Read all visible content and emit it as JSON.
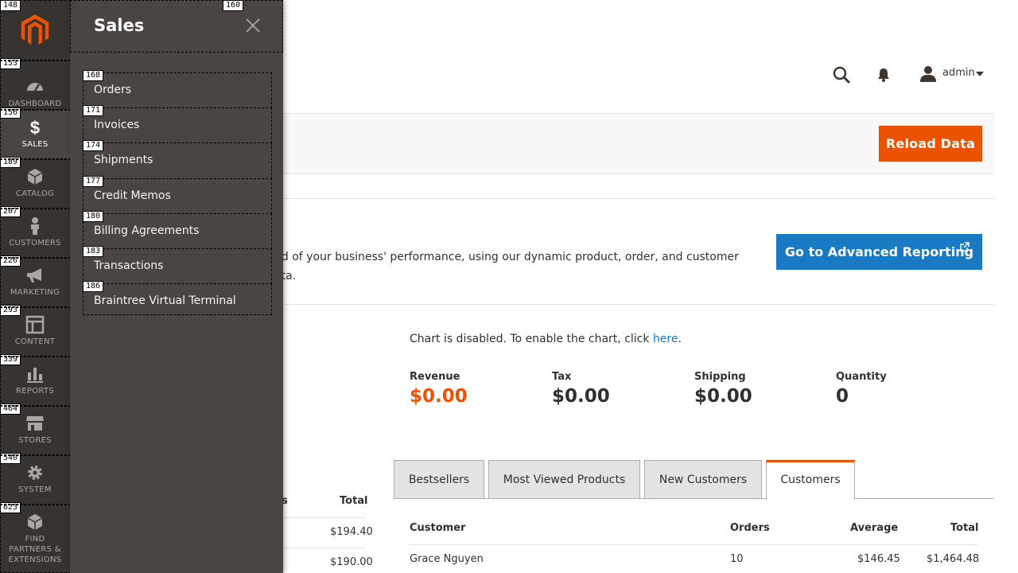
{
  "nav": {
    "badges": {
      "logo": "148",
      "dashboard": "153",
      "sales": "156",
      "catalog": "189",
      "customers": "207",
      "marketing": "226",
      "content": "293",
      "reports": "339",
      "stores": "464",
      "system": "540",
      "partners": "623"
    },
    "items": [
      {
        "label": "DASHBOARD",
        "icon": "dashboard-icon"
      },
      {
        "label": "SALES",
        "icon": "dollar-icon"
      },
      {
        "label": "CATALOG",
        "icon": "cube-icon"
      },
      {
        "label": "CUSTOMERS",
        "icon": "person-icon"
      },
      {
        "label": "MARKETING",
        "icon": "megaphone-icon"
      },
      {
        "label": "CONTENT",
        "icon": "layout-icon"
      },
      {
        "label": "REPORTS",
        "icon": "bar-chart-icon"
      },
      {
        "label": "STORES",
        "icon": "store-icon"
      },
      {
        "label": "SYSTEM",
        "icon": "gear-icon"
      },
      {
        "label": "FIND PARTNERS & EXTENSIONS",
        "icon": "boxes-icon"
      }
    ]
  },
  "flyout": {
    "title": "Sales",
    "title_badge": "160",
    "items": [
      {
        "label": "Orders",
        "badge": "168"
      },
      {
        "label": "Invoices",
        "badge": "171"
      },
      {
        "label": "Shipments",
        "badge": "174"
      },
      {
        "label": "Credit Memos",
        "badge": "177"
      },
      {
        "label": "Billing Agreements",
        "badge": "180"
      },
      {
        "label": "Transactions",
        "badge": "183"
      },
      {
        "label": "Braintree Virtual Terminal",
        "badge": "186"
      }
    ]
  },
  "header": {
    "user": "admin"
  },
  "actions": {
    "reload": "Reload Data",
    "advanced": "Go to Advanced Reporting"
  },
  "intro": {
    "line1": "nd of your business' performance, using our dynamic product, order, and customer",
    "line2": "ata."
  },
  "chart": {
    "msg_prefix": "Chart is disabled. To enable the chart, click ",
    "msg_link": "here",
    "msg_suffix": "."
  },
  "stats": [
    {
      "title": "Revenue",
      "value": "$0.00",
      "color": "#eb5202"
    },
    {
      "title": "Tax",
      "value": "$0.00",
      "color": "#303030"
    },
    {
      "title": "Shipping",
      "value": "$0.00",
      "color": "#303030"
    },
    {
      "title": "Quantity",
      "value": "0",
      "color": "#303030"
    }
  ],
  "left_table": {
    "col_partial": "s",
    "col_total": "Total",
    "rows": [
      "$194.40",
      "$190.00"
    ]
  },
  "tabs": [
    "Bestsellers",
    "Most Viewed Products",
    "New Customers",
    "Customers"
  ],
  "customers_table": {
    "headers": [
      "Customer",
      "Orders",
      "Average",
      "Total"
    ],
    "rows": [
      {
        "customer": "Grace Nguyen",
        "orders": "10",
        "average": "$146.45",
        "total": "$1,464.48"
      }
    ]
  }
}
